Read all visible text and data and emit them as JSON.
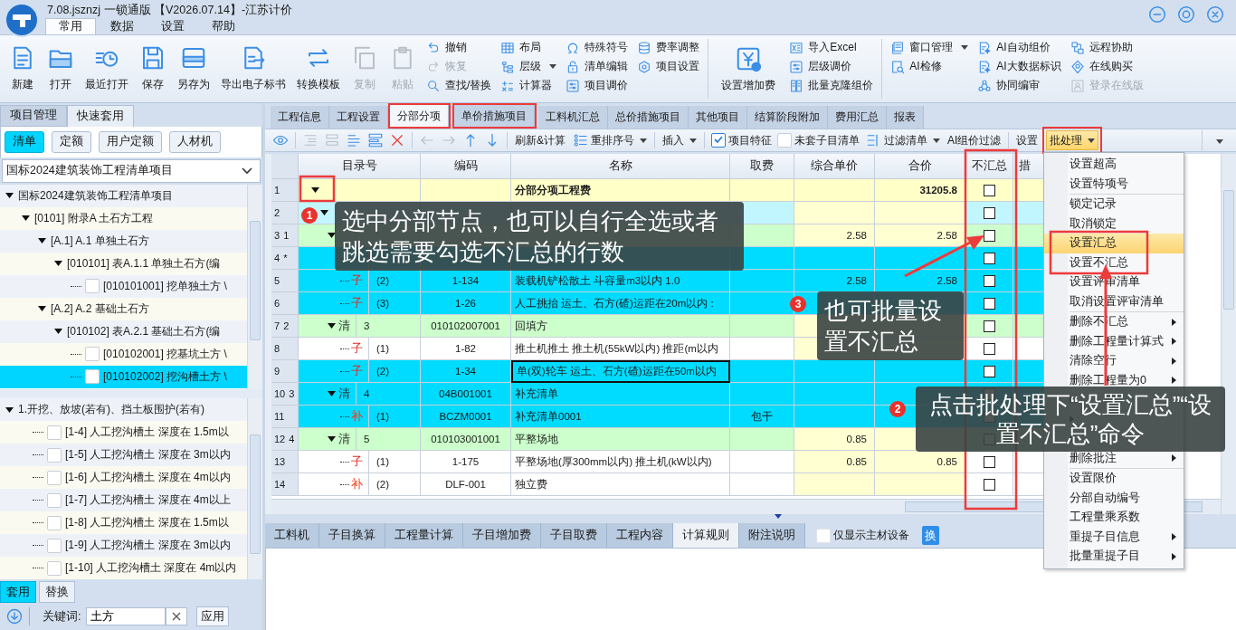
{
  "window": {
    "title": "7.08.jsznzj 一锁通版 【V2026.07.14】-江苏计价"
  },
  "menu_tabs": [
    {
      "label": "常用",
      "selected": true
    },
    {
      "label": "数据",
      "selected": false
    },
    {
      "label": "设置",
      "selected": false
    },
    {
      "label": "帮助",
      "selected": false
    }
  ],
  "ribbon": {
    "groups": [
      {
        "items": [
          {
            "kind": "large",
            "label": "新建",
            "disabled": false
          },
          {
            "kind": "large",
            "label": "打开",
            "disabled": false
          },
          {
            "kind": "large",
            "label": "最近打开",
            "disabled": false
          },
          {
            "kind": "large",
            "label": "保存",
            "disabled": false
          },
          {
            "kind": "large",
            "label": "另存为",
            "disabled": false
          },
          {
            "kind": "large",
            "label": "导出电子标书",
            "disabled": false
          },
          {
            "kind": "large",
            "label": "转换模板",
            "disabled": false
          },
          {
            "kind": "large",
            "label": "复制",
            "disabled": true
          },
          {
            "kind": "large",
            "label": "粘贴",
            "disabled": true
          },
          {
            "kind": "column",
            "buttons": [
              {
                "label": "撤销",
                "disabled": false,
                "dropdown": false
              },
              {
                "label": "恢复",
                "disabled": true,
                "dropdown": false
              },
              {
                "label": "查找/替换",
                "disabled": false,
                "dropdown": false
              }
            ]
          },
          {
            "kind": "column",
            "buttons": [
              {
                "label": "布局",
                "disabled": false,
                "dropdown": false
              },
              {
                "label": "层级",
                "disabled": false,
                "dropdown": true
              },
              {
                "label": "计算器",
                "disabled": false,
                "dropdown": false
              }
            ]
          },
          {
            "kind": "column",
            "buttons": [
              {
                "label": "特殊符号",
                "disabled": false,
                "dropdown": false
              },
              {
                "label": "清单编辑",
                "disabled": false,
                "dropdown": false
              },
              {
                "label": "项目调价",
                "disabled": false,
                "dropdown": false
              }
            ]
          },
          {
            "kind": "column",
            "buttons": [
              {
                "label": "费率调整",
                "disabled": false,
                "dropdown": false
              },
              {
                "label": "项目设置",
                "disabled": false,
                "dropdown": false
              }
            ]
          }
        ]
      },
      {
        "items": [
          {
            "kind": "large",
            "label": "设置增加费",
            "disabled": false
          },
          {
            "kind": "column",
            "buttons": [
              {
                "label": "导入Excel",
                "disabled": false,
                "dropdown": false
              },
              {
                "label": "层级调价",
                "disabled": false,
                "dropdown": false
              },
              {
                "label": "批量克隆组价",
                "disabled": false,
                "dropdown": false
              }
            ]
          }
        ]
      },
      {
        "items": [
          {
            "kind": "column",
            "buttons": [
              {
                "label": "窗口管理",
                "disabled": false,
                "dropdown": true
              },
              {
                "label": "AI检修",
                "disabled": false,
                "dropdown": false
              }
            ]
          },
          {
            "kind": "column",
            "buttons": [
              {
                "label": "AI自动组价",
                "disabled": false,
                "dropdown": false
              },
              {
                "label": "AI大数据标识",
                "disabled": false,
                "dropdown": false
              },
              {
                "label": "协同编审",
                "disabled": false,
                "dropdown": false
              }
            ]
          },
          {
            "kind": "column",
            "buttons": [
              {
                "label": "远程协助",
                "disabled": false,
                "dropdown": false
              },
              {
                "label": "在线购买",
                "disabled": false,
                "dropdown": false
              },
              {
                "label": "登录在线版",
                "disabled": true,
                "dropdown": false
              }
            ]
          }
        ]
      }
    ]
  },
  "left_panel": {
    "tabs": [
      {
        "label": "项目管理",
        "selected": false
      },
      {
        "label": "快速套用",
        "selected": true
      }
    ],
    "filters": [
      {
        "label": "清单",
        "selected": true
      },
      {
        "label": "定额",
        "selected": false
      },
      {
        "label": "用户定额",
        "selected": false
      },
      {
        "label": "人材机",
        "selected": false
      }
    ],
    "library": "国标2024建筑装饰工程清单项目",
    "list_tree": [
      {
        "label": "国标2024建筑装饰工程清单项目",
        "expanded": true,
        "selected": false,
        "children": [
          {
            "label": "[0101] 附录A 土石方工程",
            "expanded": true,
            "selected": false,
            "children": [
              {
                "label": "[A.1] A.1 单独土石方",
                "expanded": true,
                "selected": false,
                "children": [
                  {
                    "label": "[010101] 表A.1.1 单独土石方(编",
                    "expanded": true,
                    "selected": false,
                    "children": [
                      {
                        "label": "[010101001] 挖单独土方 \\",
                        "checked": false,
                        "selected": false
                      }
                    ]
                  }
                ]
              },
              {
                "label": "[A.2] A.2 基础土石方",
                "expanded": true,
                "selected": false,
                "children": [
                  {
                    "label": "[010102] 表A.2.1 基础土石方(编",
                    "expanded": true,
                    "selected": false,
                    "children": [
                      {
                        "label": "[010102001] 挖基坑土方 \\",
                        "checked": false,
                        "selected": false
                      },
                      {
                        "label": "[010102002] 挖沟槽土方 \\",
                        "checked": false,
                        "selected": true
                      }
                    ]
                  }
                ]
              }
            ]
          }
        ]
      }
    ],
    "quota_tree": [
      {
        "label": "1.开挖、放坡(若有)、挡土板围护(若有)",
        "expanded": true,
        "selected": false,
        "children": [
          {
            "label": "[1-4] 人工挖沟槽土 深度在 1.5m以",
            "checked": false,
            "selected": false
          },
          {
            "label": "[1-5] 人工挖沟槽土 深度在 3m以内",
            "checked": false,
            "selected": false
          },
          {
            "label": "[1-6] 人工挖沟槽土 深度在 4m以内",
            "checked": false,
            "selected": false
          },
          {
            "label": "[1-7] 人工挖沟槽土 深度在 4m以上",
            "checked": false,
            "selected": false
          },
          {
            "label": "[1-8] 人工挖沟槽土 深度在 1.5m以",
            "checked": false,
            "selected": false
          },
          {
            "label": "[1-9] 人工挖沟槽土 深度在 3m以内",
            "checked": false,
            "selected": false
          },
          {
            "label": "[1-10] 人工挖沟槽土 深度在 4m以内",
            "checked": false,
            "selected": false
          }
        ]
      }
    ],
    "bottom_tabs": [
      {
        "label": "套用",
        "selected": true
      },
      {
        "label": "替换",
        "selected": false
      }
    ],
    "keyword": {
      "label": "关键词:",
      "value": "土方"
    },
    "apply_button": "应用"
  },
  "main_tabs": [
    {
      "label": "工程信息",
      "selected": false
    },
    {
      "label": "工程设置",
      "selected": false
    },
    {
      "label": "分部分项",
      "selected": true
    },
    {
      "label": "单价措施项目",
      "selected": false
    },
    {
      "label": "工料机汇总",
      "selected": false
    },
    {
      "label": "总价措施项目",
      "selected": false
    },
    {
      "label": "其他项目",
      "selected": false
    },
    {
      "label": "结算阶段附加",
      "selected": false
    },
    {
      "label": "费用汇总",
      "selected": false
    },
    {
      "label": "报表",
      "selected": false
    }
  ],
  "toolbar": [
    {
      "kind": "icon",
      "disabled": false
    },
    {
      "kind": "separator"
    },
    {
      "kind": "icon",
      "disabled": true
    },
    {
      "kind": "icon",
      "disabled": true
    },
    {
      "kind": "icon",
      "disabled": false
    },
    {
      "kind": "icon",
      "disabled": false
    },
    {
      "kind": "icon",
      "disabled": false
    },
    {
      "kind": "separator"
    },
    {
      "kind": "icon",
      "disabled": true
    },
    {
      "kind": "icon",
      "disabled": true
    },
    {
      "kind": "icon",
      "disabled": false
    },
    {
      "kind": "icon",
      "disabled": false
    },
    {
      "kind": "separator"
    },
    {
      "kind": "text",
      "label": "刷新&计算",
      "dropdown": false,
      "active": false
    },
    {
      "kind": "text",
      "label": "重排序号",
      "dropdown": true,
      "active": false
    },
    {
      "kind": "separator"
    },
    {
      "kind": "text",
      "label": "插入",
      "dropdown": true,
      "active": false
    },
    {
      "kind": "separator"
    },
    {
      "kind": "checkbox",
      "label": "项目特征",
      "checked": true
    },
    {
      "kind": "checkbox",
      "label": "未套子目清单",
      "checked": false
    },
    {
      "kind": "text",
      "label": "过滤清单",
      "dropdown": true,
      "active": false
    },
    {
      "kind": "text",
      "label": "AI组价过滤",
      "dropdown": false,
      "active": false
    },
    {
      "kind": "separator"
    },
    {
      "kind": "text",
      "label": "设置",
      "dropdown": false,
      "active": false
    },
    {
      "kind": "text",
      "label": "批处理",
      "dropdown": true,
      "active": true
    }
  ],
  "grid": {
    "columns": [
      "目录号",
      "编码",
      "名称",
      "取费",
      "综合单价",
      "合价",
      "不汇总",
      "措"
    ],
    "rows": [
      {
        "num": "1",
        "kind": "fenbu",
        "expanded": true,
        "name": "分部分项工程费",
        "total": "31205.8",
        "selected": false,
        "focused": false,
        "unsummed": false,
        "children": [
          {
            "num": "2",
            "kind": "section",
            "expanded": true,
            "selected": false,
            "focused": false,
            "unsummed": false,
            "children": [
              {
                "num": "3",
                "mark": "1",
                "kind": "qing",
                "expanded": true,
                "unit_price": "2.58",
                "total": "2.58",
                "selected": false,
                "focused": false,
                "unsummed": false,
                "children": [
                  {
                    "num": "4",
                    "mark": "*",
                    "kind": "zi",
                    "selected": true,
                    "focused": false,
                    "unsummed": false
                  },
                  {
                    "num": "5",
                    "kind": "zi",
                    "type": "子",
                    "seq": "(2)",
                    "code": "1-134",
                    "name": "装载机铲松散土 斗容量m3以内 1.0",
                    "unit_price": "2.58",
                    "total": "2.58",
                    "selected": true,
                    "focused": false,
                    "unsummed": false
                  },
                  {
                    "num": "6",
                    "kind": "zi",
                    "type": "子",
                    "seq": "(3)",
                    "code": "1-26",
                    "name": "人工挑抬 运土、石方(碴)运距在20m以内 :",
                    "selected": true,
                    "focused": false,
                    "unsummed": false
                  }
                ]
              },
              {
                "num": "7",
                "mark": "2",
                "kind": "qing",
                "type": "清",
                "seq": "3",
                "code": "010102007001",
                "name": "回填方",
                "expanded": true,
                "selected": false,
                "focused": false,
                "unsummed": false,
                "children": [
                  {
                    "num": "8",
                    "kind": "zi",
                    "type": "子",
                    "seq": "(1)",
                    "code": "1-82",
                    "name": "推土机推土 推土机(55kW以内) 推距(m以内",
                    "selected": false,
                    "focused": false,
                    "unsummed": false
                  },
                  {
                    "num": "9",
                    "kind": "zi",
                    "type": "子",
                    "seq": "(2)",
                    "code": "1-34",
                    "name": "单(双)轮车 运土、石方(碴)运距在50m以内",
                    "selected": true,
                    "focused": true,
                    "unsummed": false
                  }
                ]
              },
              {
                "num": "10",
                "mark": "3",
                "kind": "qing",
                "type": "清",
                "seq": "4",
                "code": "04B001001",
                "name": "补充清单",
                "expanded": true,
                "selected": true,
                "focused": false,
                "unsummed": false,
                "children": [
                  {
                    "num": "11",
                    "kind": "bu",
                    "type": "补",
                    "seq": "(1)",
                    "code": "BCZM0001",
                    "name": "补充清单0001",
                    "fee": "包干",
                    "selected": true,
                    "focused": false,
                    "unsummed": false
                  }
                ]
              },
              {
                "num": "12",
                "mark": "4",
                "kind": "qing",
                "type": "清",
                "seq": "5",
                "code": "010103001001",
                "name": "平整场地",
                "unit_price": "0.85",
                "expanded": true,
                "selected": false,
                "focused": false,
                "unsummed": false,
                "children": [
                  {
                    "num": "13",
                    "kind": "zi",
                    "type": "子",
                    "seq": "(1)",
                    "code": "1-175",
                    "name": "平整场地(厚300mm以内) 推土机(kW以内)",
                    "unit_price": "0.85",
                    "total": "0.85",
                    "selected": false,
                    "focused": false,
                    "unsummed": false
                  },
                  {
                    "num": "14",
                    "kind": "bu",
                    "type": "补",
                    "seq": "(2)",
                    "code": "DLF-001",
                    "name": "独立费",
                    "selected": false,
                    "focused": false,
                    "unsummed": false
                  }
                ]
              }
            ]
          }
        ]
      }
    ]
  },
  "batch_menu": {
    "items": [
      {
        "kind": "item",
        "label": "设置超高",
        "submenu": false,
        "highlighted": false
      },
      {
        "kind": "item",
        "label": "设置特项号",
        "submenu": false,
        "highlighted": false
      },
      {
        "kind": "separator"
      },
      {
        "kind": "item",
        "label": "锁定记录",
        "submenu": false,
        "highlighted": false
      },
      {
        "kind": "item",
        "label": "取消锁定",
        "submenu": false,
        "highlighted": false
      },
      {
        "kind": "item",
        "label": "设置汇总",
        "submenu": false,
        "highlighted": true
      },
      {
        "kind": "item",
        "label": "设置不汇总",
        "submenu": false,
        "highlighted": false
      },
      {
        "kind": "item",
        "label": "设置评审清单",
        "submenu": false,
        "highlighted": false
      },
      {
        "kind": "item",
        "label": "取消设置评审清单",
        "submenu": false,
        "highlighted": false
      },
      {
        "kind": "separator"
      },
      {
        "kind": "item",
        "label": "删除不汇总",
        "submenu": true,
        "highlighted": false
      },
      {
        "kind": "item",
        "label": "删除工程量计算式",
        "submenu": true,
        "highlighted": false
      },
      {
        "kind": "item",
        "label": "清除空行",
        "submenu": true,
        "highlighted": false
      },
      {
        "kind": "item",
        "label": "删除工程量为0",
        "submenu": true,
        "highlighted": false
      },
      {
        "kind": "item",
        "submenu": true,
        "highlighted": false
      },
      {
        "kind": "item",
        "submenu": true,
        "highlighted": false
      },
      {
        "kind": "item",
        "submenu": true,
        "highlighted": false
      },
      {
        "kind": "item",
        "label": "删除批注",
        "submenu": true,
        "highlighted": false
      },
      {
        "kind": "separator"
      },
      {
        "kind": "item",
        "label": "设置限价",
        "submenu": false,
        "highlighted": false
      },
      {
        "kind": "item",
        "label": "分部自动编号",
        "submenu": false,
        "highlighted": false
      },
      {
        "kind": "item",
        "label": "工程量乘系数",
        "submenu": false,
        "highlighted": false
      },
      {
        "kind": "item",
        "label": "重提子目信息",
        "submenu": true,
        "highlighted": false
      },
      {
        "kind": "item",
        "label": "批量重提子目",
        "submenu": true,
        "highlighted": false
      }
    ]
  },
  "detail_tabs": [
    {
      "label": "工料机",
      "selected": false
    },
    {
      "label": "子目换算",
      "selected": false
    },
    {
      "label": "工程量计算",
      "selected": false
    },
    {
      "label": "子目增加费",
      "selected": false
    },
    {
      "label": "子目取费",
      "selected": false
    },
    {
      "label": "工程内容",
      "selected": false
    },
    {
      "label": "计算规则",
      "selected": true
    },
    {
      "label": "附注说明",
      "selected": false
    }
  ],
  "main_material_only": {
    "label": "仅显示主材设备",
    "checked": false
  },
  "swap_button": "换",
  "annotations": [
    {
      "badge": "1",
      "text": "选中分部节点，也可以自行全选或者跳选需要勾选不汇总的行数"
    },
    {
      "badge": "2",
      "text": "点击批处理下“设置汇总”“设置不汇总”命令"
    },
    {
      "badge": "3",
      "text": "也可批量设置不汇总"
    }
  ]
}
